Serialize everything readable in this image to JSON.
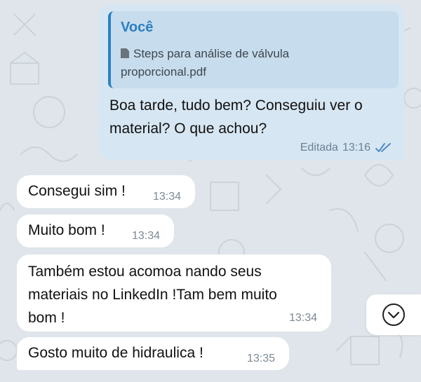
{
  "colors": {
    "background": "#dfe5ea",
    "outgoing_bubble": "#d6e6f2",
    "reply_block": "#c7dcec",
    "reply_accent": "#2b83c4",
    "incoming_bubble": "#ffffff",
    "read_checks": "#3b7fc0"
  },
  "outgoing": {
    "reply": {
      "author": "Você",
      "file_icon": "file-icon",
      "file_name": "Steps para análise de válvula proporcional.pdf"
    },
    "text": "Boa tarde, tudo bem? Conseguiu ver o material? O que achou?",
    "edited_label": "Editada",
    "time": "13:16",
    "status_icon": "double-check-icon"
  },
  "incoming": [
    {
      "text": "Consegui sim !",
      "time": "13:34"
    },
    {
      "text": "Muito bom !",
      "time": "13:34"
    },
    {
      "text": "Também estou acomoa nando seus materiais no LinkedIn !Tam bem muito bom !",
      "time": "13:34"
    },
    {
      "text": "Gosto muito de hidraulica !",
      "time": "13:35"
    }
  ],
  "scroll_button_icon": "chevron-down-icon"
}
